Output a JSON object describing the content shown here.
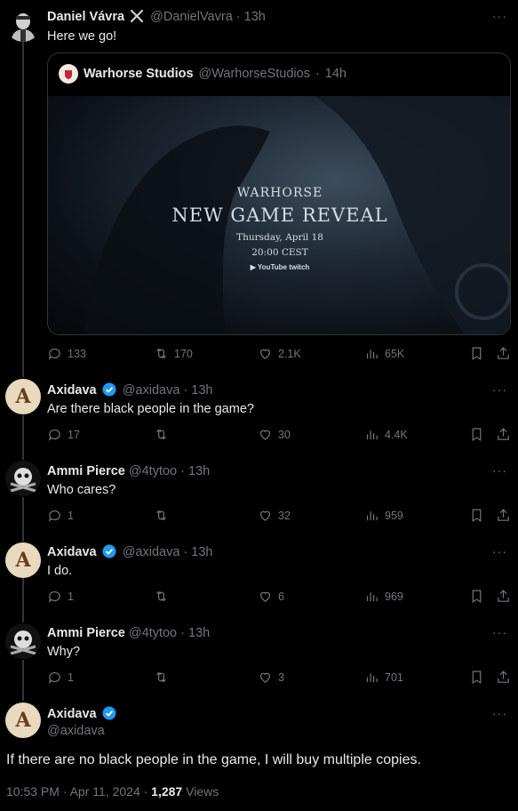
{
  "thread": [
    {
      "name": "Daniel Vávra",
      "badge": "⚔",
      "handle": "@DanielVavra",
      "time": "13h",
      "text": "Here we go!",
      "quote": {
        "name": "Warhorse Studios",
        "handle": "@WarhorseStudios",
        "time": "14h",
        "media": {
          "logo": "WARHORSE",
          "title": "NEW GAME REVEAL",
          "date": "Thursday, April 18",
          "time": "20:00 CEST",
          "platforms": "▶ YouTube   twitch"
        }
      },
      "stats": {
        "replies": "133",
        "reposts": "170",
        "likes": "2.1K",
        "views": "65K"
      }
    },
    {
      "name": "Axidava",
      "handle": "@axidava",
      "time": "13h",
      "text": "Are there black people in the game?",
      "stats": {
        "replies": "17",
        "reposts": "",
        "likes": "30",
        "views": "4.4K"
      }
    },
    {
      "name": "Ammi Pierce",
      "handle": "@4tytoo",
      "time": "13h",
      "text": "Who cares?",
      "stats": {
        "replies": "1",
        "reposts": "",
        "likes": "32",
        "views": "959"
      }
    },
    {
      "name": "Axidava",
      "handle": "@axidava",
      "time": "13h",
      "text": "I do.",
      "stats": {
        "replies": "1",
        "reposts": "",
        "likes": "6",
        "views": "969"
      }
    },
    {
      "name": "Ammi Pierce",
      "handle": "@4tytoo",
      "time": "13h",
      "text": "Why?",
      "stats": {
        "replies": "1",
        "reposts": "",
        "likes": "3",
        "views": "701"
      }
    }
  ],
  "main": {
    "name": "Axidava",
    "handle": "@axidava",
    "text": "If there are no black people in the game, I will buy multiple copies.",
    "timestamp": "10:53 PM · Apr 11, 2024 · ",
    "views_count": "1,287",
    "views_label": " Views"
  },
  "avatar_letter": "A",
  "more_label": "···",
  "colors": {
    "bg": "#000000",
    "text": "#e7e9ea",
    "muted": "#71767b",
    "verified": "#1d9bf0",
    "border": "#2f3336"
  }
}
